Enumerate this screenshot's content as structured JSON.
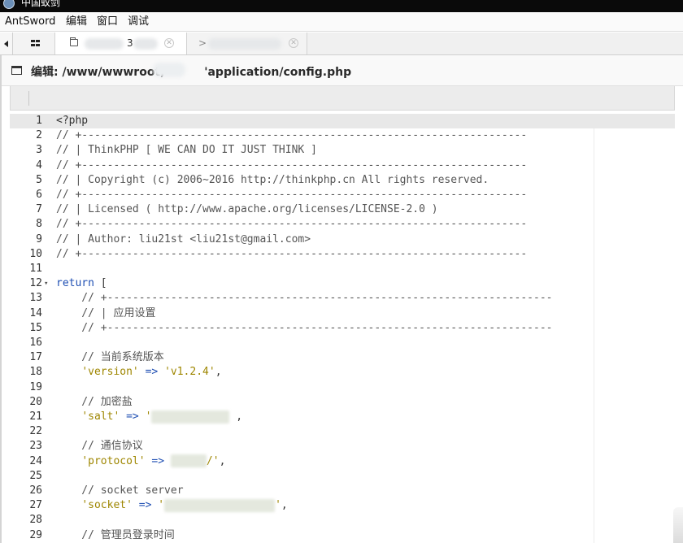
{
  "window": {
    "title": "中国蚁剑"
  },
  "menu": {
    "items": [
      "AntSword",
      "编辑",
      "窗口",
      "调试"
    ]
  },
  "tabs": [
    {
      "label": "3",
      "active": true
    },
    {
      "label": ">",
      "active": false
    }
  ],
  "panel": {
    "title": "编辑: /www/wwwroot,          'application/config.php"
  },
  "editor": {
    "lines": [
      {
        "n": "1",
        "parts": [
          [
            "plain",
            "<?php"
          ]
        ]
      },
      {
        "n": "2",
        "parts": [
          [
            "comment",
            "// +----------------------------------------------------------------------"
          ]
        ]
      },
      {
        "n": "3",
        "parts": [
          [
            "comment",
            "// | ThinkPHP [ WE CAN DO IT JUST THINK ]"
          ]
        ]
      },
      {
        "n": "4",
        "parts": [
          [
            "comment",
            "// +----------------------------------------------------------------------"
          ]
        ]
      },
      {
        "n": "5",
        "parts": [
          [
            "comment",
            "// | Copyright (c) 2006~2016 http://thinkphp.cn All rights reserved."
          ]
        ]
      },
      {
        "n": "6",
        "parts": [
          [
            "comment",
            "// +----------------------------------------------------------------------"
          ]
        ]
      },
      {
        "n": "7",
        "parts": [
          [
            "comment",
            "// | Licensed ( http://www.apache.org/licenses/LICENSE-2.0 )"
          ]
        ]
      },
      {
        "n": "8",
        "parts": [
          [
            "comment",
            "// +----------------------------------------------------------------------"
          ]
        ]
      },
      {
        "n": "9",
        "parts": [
          [
            "comment",
            "// | Author: liu21st <liu21st@gmail.com>"
          ]
        ]
      },
      {
        "n": "10",
        "parts": [
          [
            "comment",
            "// +----------------------------------------------------------------------"
          ]
        ]
      },
      {
        "n": "11",
        "parts": []
      },
      {
        "n": "12",
        "fold": true,
        "parts": [
          [
            "keyword",
            "return"
          ],
          [
            "plain",
            " ["
          ]
        ]
      },
      {
        "n": "13",
        "parts": [
          [
            "comment",
            "    // +----------------------------------------------------------------------"
          ]
        ]
      },
      {
        "n": "14",
        "parts": [
          [
            "comment",
            "    // | "
          ],
          [
            "comment-cn",
            "应用设置"
          ]
        ]
      },
      {
        "n": "15",
        "parts": [
          [
            "comment",
            "    // +----------------------------------------------------------------------"
          ]
        ]
      },
      {
        "n": "16",
        "parts": []
      },
      {
        "n": "17",
        "parts": [
          [
            "comment",
            "    // "
          ],
          [
            "comment-cn",
            "当前系统版本"
          ]
        ]
      },
      {
        "n": "18",
        "parts": [
          [
            "plain",
            "    "
          ],
          [
            "string",
            "'version'"
          ],
          [
            "op",
            " => "
          ],
          [
            "string",
            "'v1.2.4'"
          ],
          [
            "plain",
            ","
          ]
        ]
      },
      {
        "n": "19",
        "parts": []
      },
      {
        "n": "20",
        "parts": [
          [
            "comment",
            "    // "
          ],
          [
            "comment-cn",
            "加密盐"
          ]
        ]
      },
      {
        "n": "21",
        "parts": [
          [
            "plain",
            "    "
          ],
          [
            "string",
            "'salt'"
          ],
          [
            "op",
            " => "
          ],
          [
            "string",
            "'"
          ],
          [
            "redact",
            "96"
          ],
          [
            "plain",
            " ,"
          ]
        ]
      },
      {
        "n": "22",
        "parts": []
      },
      {
        "n": "23",
        "parts": [
          [
            "comment",
            "    // "
          ],
          [
            "comment-cn",
            "通信协议"
          ]
        ]
      },
      {
        "n": "24",
        "parts": [
          [
            "plain",
            "    "
          ],
          [
            "string",
            "'protocol'"
          ],
          [
            "op",
            " => "
          ],
          [
            "redact",
            "44"
          ],
          [
            "string",
            "/'"
          ],
          [
            "plain",
            ","
          ]
        ]
      },
      {
        "n": "25",
        "parts": []
      },
      {
        "n": "26",
        "parts": [
          [
            "comment",
            "    // socket server"
          ]
        ]
      },
      {
        "n": "27",
        "parts": [
          [
            "plain",
            "    "
          ],
          [
            "string",
            "'socket'"
          ],
          [
            "op",
            " => "
          ],
          [
            "string",
            "'"
          ],
          [
            "redact",
            "136"
          ],
          [
            "string",
            "'"
          ],
          [
            "plain",
            ","
          ]
        ]
      },
      {
        "n": "28",
        "parts": []
      },
      {
        "n": "29",
        "parts": [
          [
            "comment",
            "    // "
          ],
          [
            "comment-cn",
            "管理员登录时间"
          ]
        ]
      }
    ]
  }
}
